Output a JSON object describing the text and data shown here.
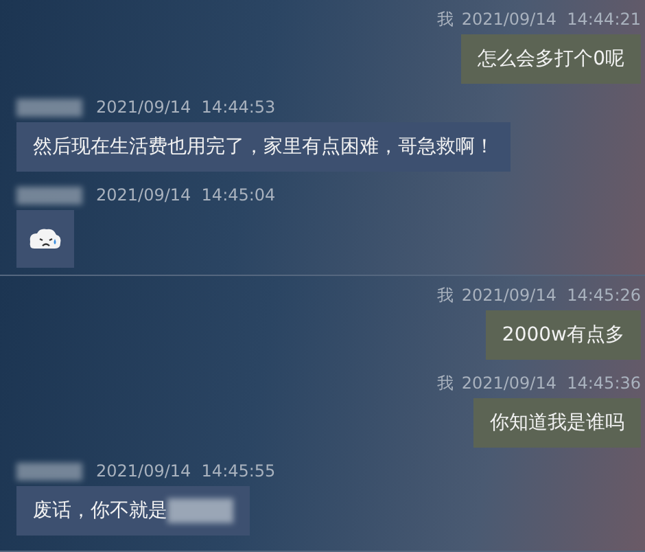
{
  "panels": [
    {
      "messages": [
        {
          "kind": "text",
          "outgoing": true,
          "sender": "我",
          "time": "2021/09/14  14:44:21",
          "text": "怎么会多打个0呢"
        },
        {
          "kind": "text",
          "outgoing": false,
          "time": "2021/09/14  14:44:53",
          "text": "然后现在生活费也用完了，家里有点困难，哥急救啊！"
        },
        {
          "kind": "sticker",
          "outgoing": false,
          "time": "2021/09/14  14:45:04"
        }
      ]
    },
    {
      "messages": [
        {
          "kind": "text",
          "outgoing": true,
          "sender": "我",
          "time": "2021/09/14  14:45:26",
          "text": "2000w有点多"
        },
        {
          "kind": "text",
          "outgoing": true,
          "sender": "我",
          "time": "2021/09/14  14:45:36",
          "text": "你知道我是谁吗"
        },
        {
          "kind": "text",
          "outgoing": false,
          "time": "2021/09/14  14:45:55",
          "text": "废话，你不就是",
          "redacted": true
        }
      ]
    }
  ]
}
